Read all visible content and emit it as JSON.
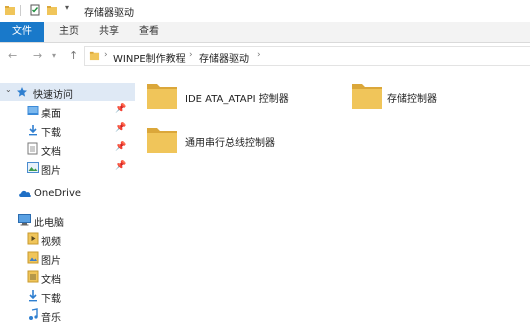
{
  "window": {
    "title": "存储器驱动"
  },
  "ribbon": {
    "tabs": [
      "文件",
      "主页",
      "共享",
      "查看"
    ]
  },
  "address": {
    "crumbs": [
      "WINPE制作教程",
      "存储器驱动"
    ]
  },
  "sidebar": {
    "quick_access": "快速访问",
    "quick_items": [
      "桌面",
      "下载",
      "文档",
      "图片"
    ],
    "onedrive": "OneDrive",
    "this_pc": "此电脑",
    "pc_items": [
      "视频",
      "图片",
      "文档",
      "下载",
      "音乐"
    ]
  },
  "content": {
    "folders": [
      "IDE ATA_ATAPI 控制器",
      "存储控制器",
      "通用串行总线控制器"
    ]
  },
  "colors": {
    "accent": "#1979ca",
    "folder": "#f0c55a",
    "folder_dark": "#dba73a",
    "selected": "#dfe9f5"
  }
}
